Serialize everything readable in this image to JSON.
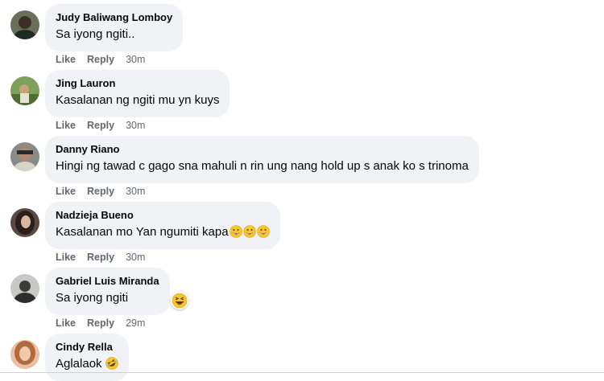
{
  "actions": {
    "like": "Like",
    "reply": "Reply"
  },
  "comments": [
    {
      "author": "Judy Baliwang Lomboy",
      "text": "Sa iyong ngiti..",
      "time": "30m"
    },
    {
      "author": "Jing Lauron",
      "text": "Kasalanan ng ngiti mu yn kuys",
      "time": "30m"
    },
    {
      "author": "Danny Riano",
      "text": "Hingi ng tawad c gago sna mahuli n rin ung nang hold up s anak ko s trinoma",
      "time": "30m"
    },
    {
      "author": "Nadzieja Bueno",
      "text": "Kasalanan mo Yan ngumiti kapa",
      "time": "30m",
      "emojis": [
        "grinning-face",
        "grinning-face",
        "grinning-face"
      ]
    },
    {
      "author": "Gabriel Luis Miranda",
      "text": "Sa iyong ngiti",
      "time": "29m",
      "reaction": "laughing-face"
    },
    {
      "author": "Cindy Rella",
      "text": "Aglalaok",
      "emojis": [
        "rolling-laughing-face"
      ]
    }
  ],
  "colors": {
    "bubble_bg": "#f0f2f5",
    "secondary_text": "#65676b",
    "primary_text": "#050505"
  }
}
